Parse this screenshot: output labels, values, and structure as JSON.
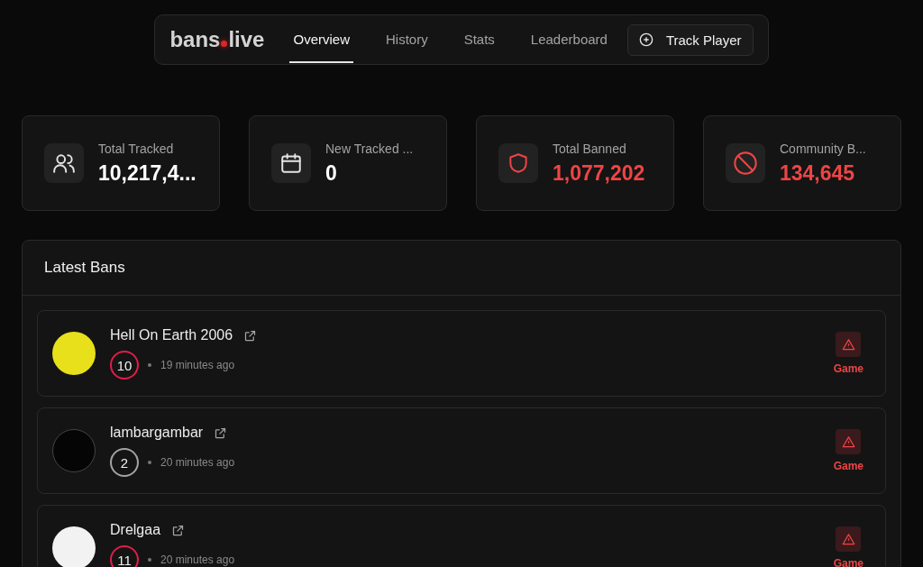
{
  "logo": {
    "parts": [
      "bans",
      "live"
    ]
  },
  "nav": [
    {
      "label": "Overview",
      "selected": true
    },
    {
      "label": "History",
      "selected": false
    },
    {
      "label": "Stats",
      "selected": false
    },
    {
      "label": "Leaderboard",
      "selected": false
    }
  ],
  "track_button": {
    "label": "Track Player"
  },
  "stats": [
    {
      "kind": "users",
      "label": "Total Tracked",
      "value": "10,217,4...",
      "color": "#ffffff"
    },
    {
      "kind": "calendar",
      "label": "New Tracked ...",
      "value": "0",
      "color": "#ffffff"
    },
    {
      "kind": "shield",
      "label": "Total Banned",
      "value": "1,077,202",
      "color": "#ef4444"
    },
    {
      "kind": "ban",
      "label": "Community B...",
      "value": "134,645",
      "color": "#ef4444"
    }
  ],
  "latest_bans": {
    "title": "Latest Bans",
    "items": [
      {
        "name": "Hell On Earth 2006",
        "count": "10",
        "color": "#e11d48",
        "time": "19 minutes ago",
        "type": "Game"
      },
      {
        "name": "lambargambar",
        "count": "2",
        "color": "#a3a3a3",
        "time": "20 minutes ago",
        "type": "Game"
      },
      {
        "name": "Drelgaa",
        "count": "11",
        "color": "#e11d48",
        "time": "20 minutes ago",
        "type": "Game"
      }
    ]
  }
}
